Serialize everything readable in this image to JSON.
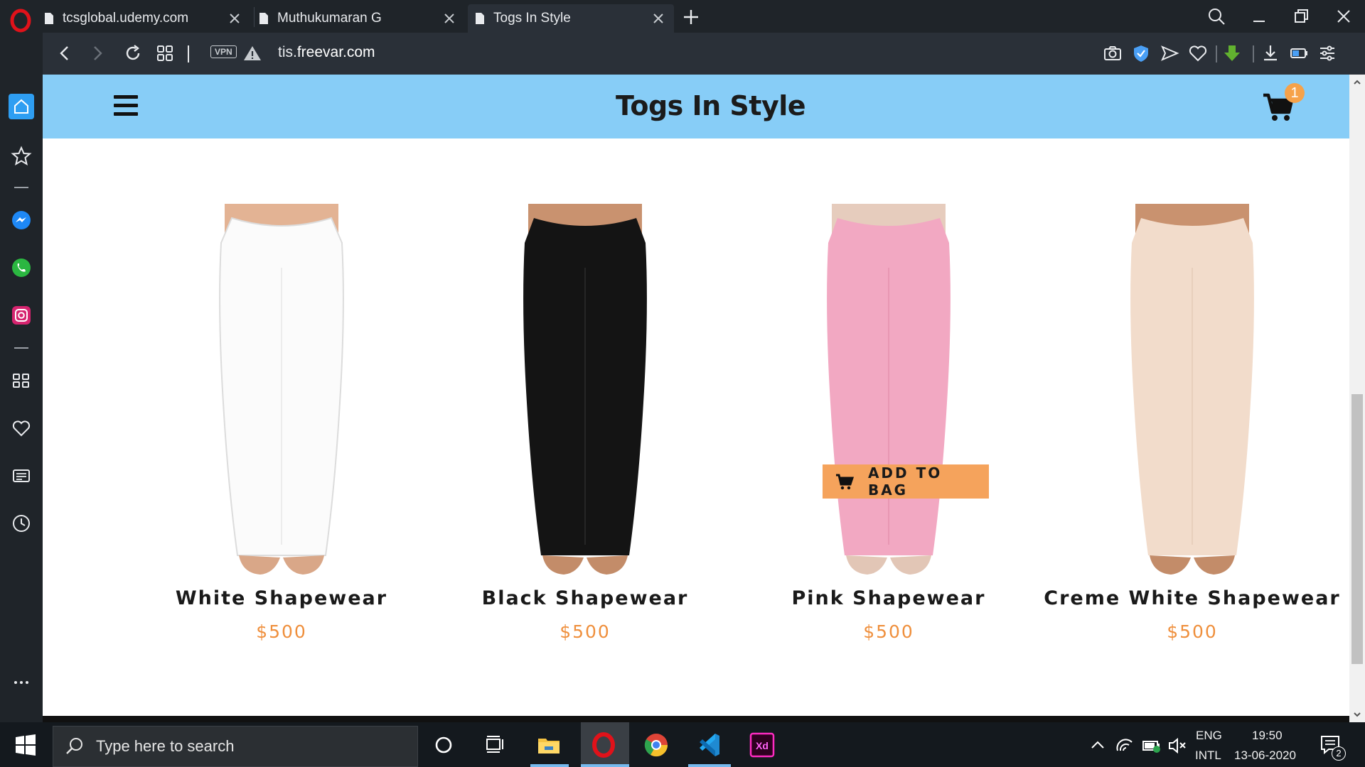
{
  "browser": {
    "tabs": [
      {
        "title": "tcsglobal.udemy.com",
        "active": false
      },
      {
        "title": "Muthukumaran G",
        "active": false
      },
      {
        "title": "Togs In Style",
        "active": true
      }
    ],
    "address": {
      "vpn_label": "VPN",
      "url_prefix": "tis.",
      "url_domain": "freevar.com"
    },
    "colors": {
      "chrome": "#1f2429",
      "toolbar": "#2a3038",
      "opera_red": "#e0121a"
    }
  },
  "site": {
    "title": "Togs In Style",
    "cart_count": "1",
    "header_color": "#87cdf7",
    "products": [
      {
        "name": "White Shapewear",
        "price": "$500",
        "color": "#ffffff"
      },
      {
        "name": "Black Shapewear",
        "price": "$500",
        "color": "#141414"
      },
      {
        "name": "Pink Shapewear",
        "price": "$500",
        "color": "#f2a8c2"
      },
      {
        "name": "Creme White Shapewear",
        "price": "$500",
        "color": "#f2dccb"
      }
    ],
    "add_to_bag_label": "ADD TO BAG",
    "accent_color": "#ef8f3c"
  },
  "taskbar": {
    "search_placeholder": "Type here to search",
    "language_line1": "ENG",
    "language_line2": "INTL",
    "time": "19:50",
    "date": "13-06-2020",
    "notification_count": "2"
  }
}
